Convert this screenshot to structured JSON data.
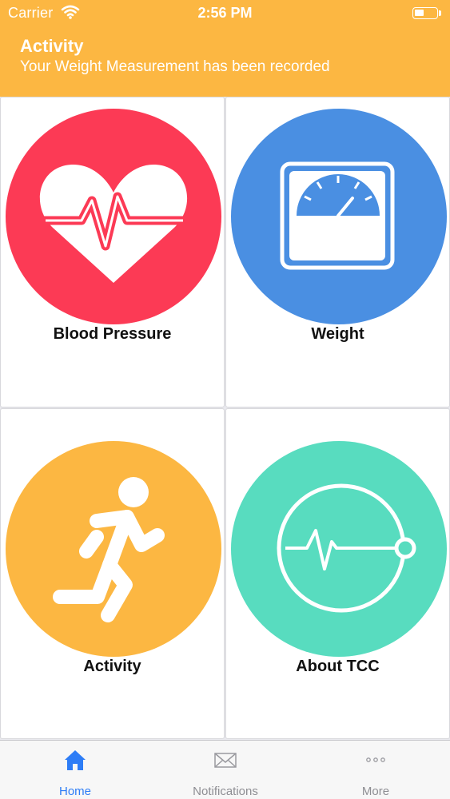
{
  "status_bar": {
    "carrier": "Carrier",
    "time": "2:56 PM"
  },
  "header": {
    "title": "Activity",
    "subtitle": "Your Weight Measurement has been recorded",
    "background_color": "#fcb742"
  },
  "tiles": [
    {
      "label": "Blood Pressure",
      "icon": "heart-pulse-icon",
      "color": "#fc3a55"
    },
    {
      "label": "Weight",
      "icon": "scale-icon",
      "color": "#4a8fe2"
    },
    {
      "label": "Activity",
      "icon": "runner-icon",
      "color": "#fcb742"
    },
    {
      "label": "About TCC",
      "icon": "pulse-circle-icon",
      "color": "#58dcbf"
    }
  ],
  "tabbar": {
    "items": [
      {
        "label": "Home",
        "icon": "home-icon",
        "active": true
      },
      {
        "label": "Notifications",
        "icon": "envelope-icon",
        "active": false
      },
      {
        "label": "More",
        "icon": "more-icon",
        "active": false
      }
    ],
    "active_color": "#2e7df6"
  }
}
